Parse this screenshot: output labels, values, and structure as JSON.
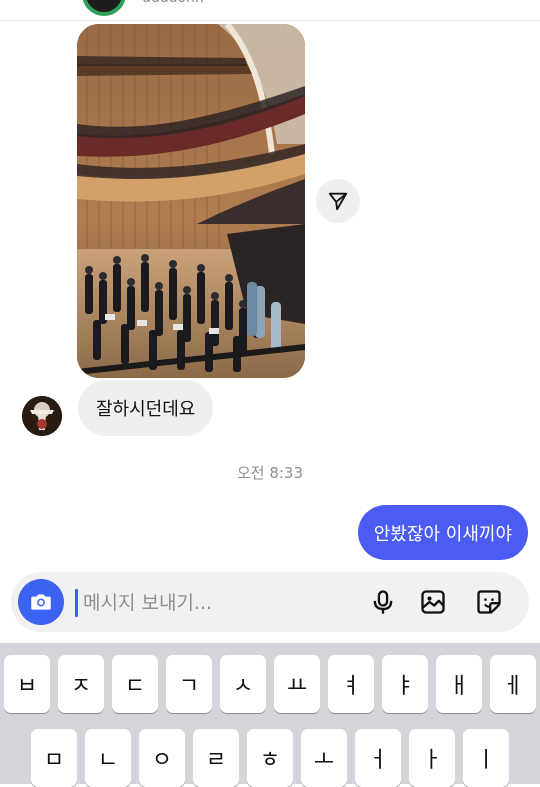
{
  "header": {
    "username": "uuuuonn"
  },
  "conversation": {
    "received_message": "잘하시던데요",
    "timestamp": "오전 8:33",
    "sent_message": "안봤잖아 이새끼야"
  },
  "composer": {
    "placeholder": "메시지 보내기...",
    "value": ""
  },
  "keyboard": {
    "row1": [
      "ㅂ",
      "ㅈ",
      "ㄷ",
      "ㄱ",
      "ㅅ",
      "ㅛ",
      "ㅕ",
      "ㅑ",
      "ㅐ",
      "ㅔ"
    ],
    "row2": [
      "ㅁ",
      "ㄴ",
      "ㅇ",
      "ㄹ",
      "ㅎ",
      "ㅗ",
      "ㅓ",
      "ㅏ",
      "ㅣ"
    ]
  },
  "icons": {
    "share": "paper-plane-icon",
    "camera": "camera-icon",
    "mic": "microphone-icon",
    "gallery": "image-icon",
    "sticker": "sticker-icon"
  },
  "colors": {
    "accent": "#3b62f0",
    "sent_bubble": "#4a5cf3",
    "received_bubble": "#efefef",
    "keyboard_bg": "#d3d5da"
  }
}
